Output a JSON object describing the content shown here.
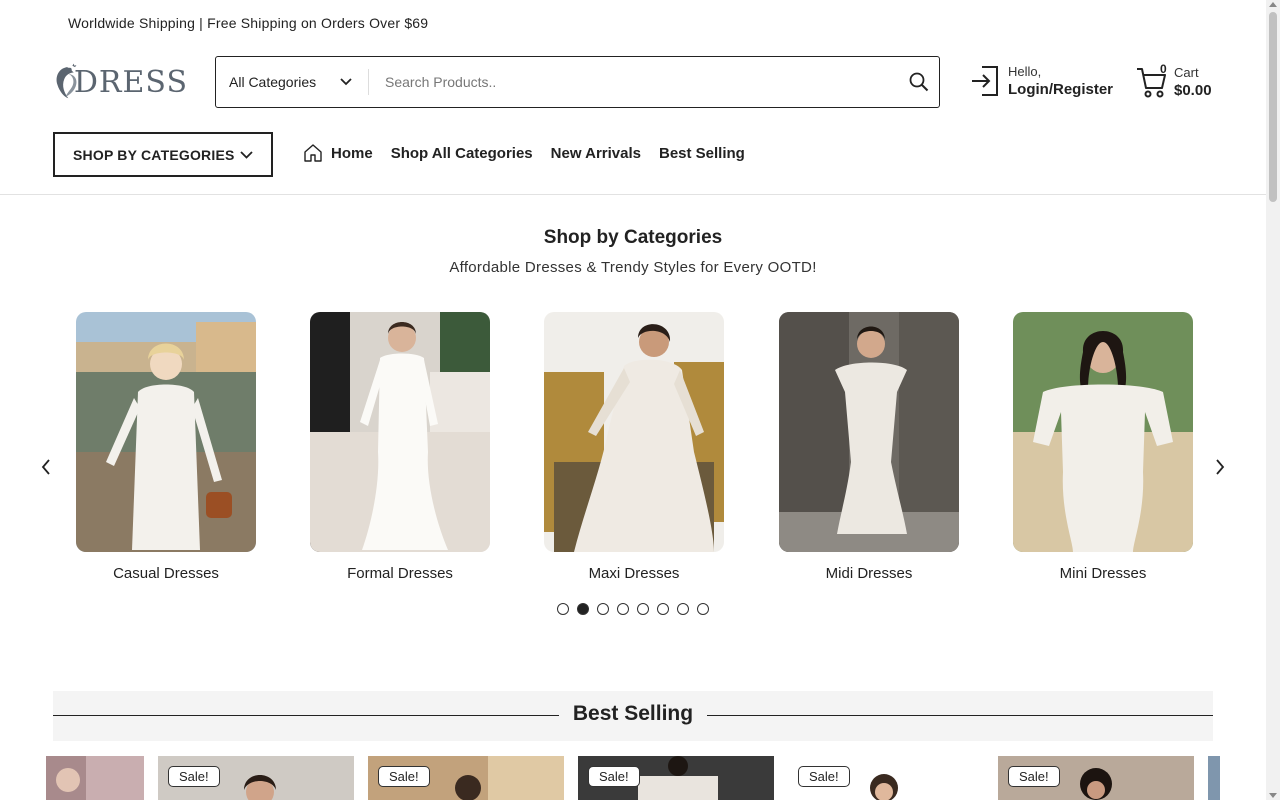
{
  "announcement": "Worldwide Shipping | Free Shipping on Orders Over $69",
  "logo": {
    "text": "DRESS"
  },
  "search": {
    "category": "All Categories",
    "placeholder": "Search Products.."
  },
  "account": {
    "greeting": "Hello,",
    "label": "Login/Register"
  },
  "cart": {
    "count": "0",
    "label": "Cart",
    "total": "$0.00"
  },
  "shop_by_categories_button": "SHOP BY CATEGORIES",
  "nav": [
    {
      "label": "Home",
      "icon": "home-icon"
    },
    {
      "label": "Shop All Categories"
    },
    {
      "label": "New Arrivals"
    },
    {
      "label": "Best Selling"
    }
  ],
  "categories_section": {
    "title": "Shop by Categories",
    "subtitle": "Affordable Dresses & Trendy Styles for Every OOTD!",
    "items": [
      {
        "label": "Casual Dresses"
      },
      {
        "label": "Formal Dresses"
      },
      {
        "label": "Maxi Dresses"
      },
      {
        "label": "Midi Dresses"
      },
      {
        "label": "Mini Dresses"
      }
    ],
    "pagination": {
      "total": 8,
      "active": 2
    }
  },
  "best_selling": {
    "title": "Best Selling",
    "badge": "Sale!",
    "products": [
      {
        "sale": false
      },
      {
        "sale": true
      },
      {
        "sale": true
      },
      {
        "sale": true
      },
      {
        "sale": true
      },
      {
        "sale": true
      }
    ]
  },
  "colors": {
    "text": "#222222",
    "band": "#f4f4f4",
    "border": "#222222"
  }
}
